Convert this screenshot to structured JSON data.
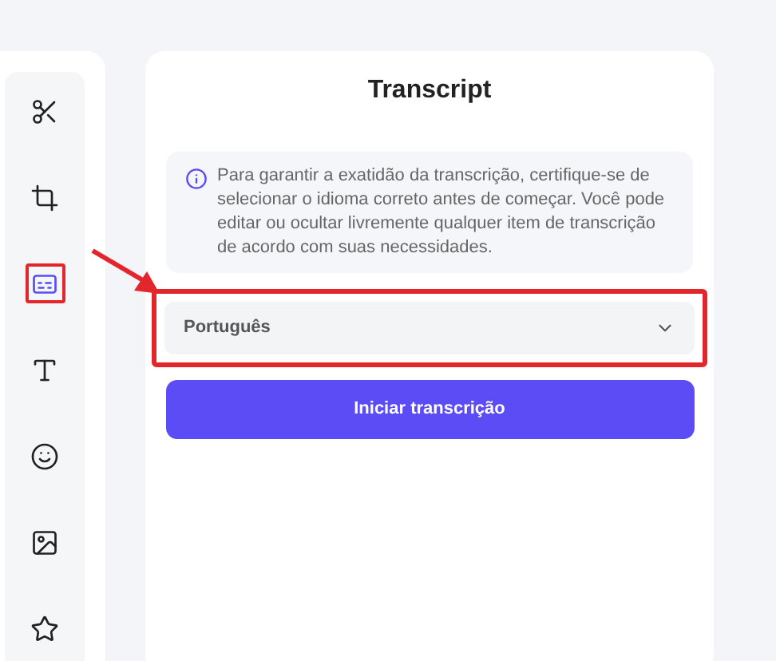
{
  "tools": [
    {
      "kind": "scissors",
      "selected": false
    },
    {
      "kind": "crop",
      "selected": false
    },
    {
      "kind": "captions",
      "selected": true
    },
    {
      "kind": "text",
      "selected": false
    },
    {
      "kind": "sticker",
      "selected": false
    },
    {
      "kind": "image",
      "selected": false
    },
    {
      "kind": "star",
      "selected": false
    }
  ],
  "panel": {
    "title": "Transcript",
    "info": "Para garantir a exatidão da transcrição, certifique-se de selecionar o idioma correto antes de começar. Você pode editar ou ocultar livremente qualquer item de transcrição de acordo com suas necessidades.",
    "language_select": {
      "value": "Português",
      "highlighted": true
    },
    "start_button": "Iniciar transcrição"
  }
}
